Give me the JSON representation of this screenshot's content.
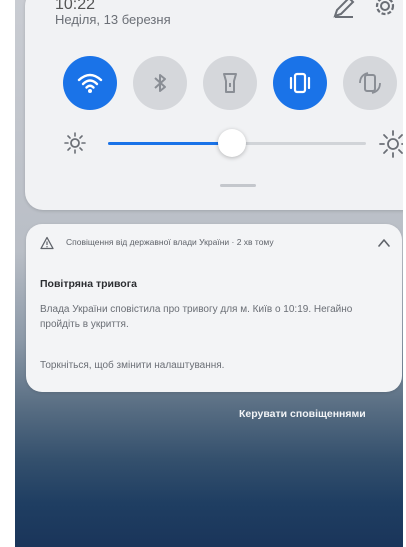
{
  "status": {
    "clock": "10:22",
    "date": "Неділя, 13 березня"
  },
  "header_icons": [
    "edit-icon",
    "gear-icon"
  ],
  "quick_tiles": [
    {
      "name": "wifi",
      "icon": "wifi-icon",
      "active": true
    },
    {
      "name": "bluetooth",
      "icon": "bluetooth-icon",
      "active": false
    },
    {
      "name": "flashlight",
      "icon": "flashlight-icon",
      "active": false
    },
    {
      "name": "vibrate",
      "icon": "vibrate-icon",
      "active": true
    },
    {
      "name": "auto-rotate",
      "icon": "rotate-icon",
      "active": false
    }
  ],
  "brightness": {
    "level": 0.48
  },
  "notification": {
    "source": "Сповіщення від державної влади України · 2 хв тому",
    "title": "Повітряна тривога",
    "body": "Влада України сповістила про тривогу для м. Київ о 10:19. Негайно пройдіть в укриття.",
    "hint": "Торкніться, щоб змінити налаштування."
  },
  "manage_label": "Керувати сповіщеннями",
  "colors": {
    "accent": "#1a73e8",
    "panel": "#f1f2f4",
    "tile_off": "#d5d7db"
  }
}
